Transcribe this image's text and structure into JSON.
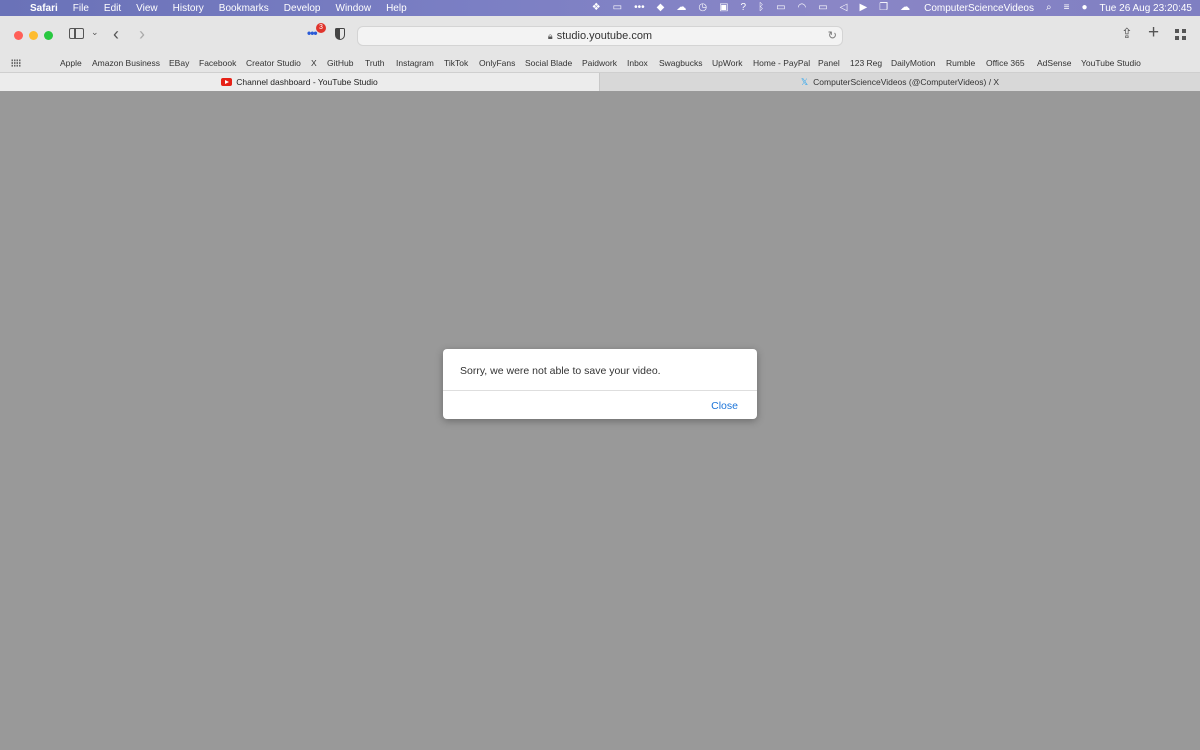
{
  "menubar": {
    "app_name": "Safari",
    "items": [
      "File",
      "Edit",
      "View",
      "History",
      "Bookmarks",
      "Develop",
      "Window",
      "Help"
    ],
    "username": "ComputerScienceVideos",
    "datetime": "Tue 26 Aug  23:20:45"
  },
  "toolbar": {
    "url": "studio.youtube.com",
    "extension_badge": "3"
  },
  "favorites": [
    "Apple",
    "Amazon Business",
    "EBay",
    "Facebook",
    "Creator Studio",
    "X",
    "GitHub",
    "Truth",
    "Instagram",
    "TikTok",
    "OnlyFans",
    "Social Blade",
    "Paidwork",
    "Inbox",
    "Swagbucks",
    "UpWork",
    "Home - PayPal",
    "Panel",
    "123 Reg",
    "DailyMotion",
    "Rumble",
    "Office 365",
    "AdSense",
    "YouTube Studio"
  ],
  "tabs": [
    {
      "title": "Channel dashboard - YouTube Studio",
      "icon": "youtube-icon"
    },
    {
      "title": "ComputerScienceVideos (@ComputerVideos) / X",
      "icon": "x-icon"
    }
  ],
  "dialog": {
    "message": "Sorry, we were not able to save your video.",
    "close_label": "Close"
  }
}
